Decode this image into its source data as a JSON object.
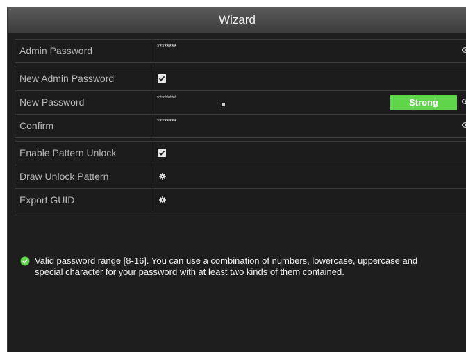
{
  "window": {
    "title": "Wizard"
  },
  "admin": {
    "label": "Admin Password",
    "value": "********"
  },
  "change": {
    "new_admin_label": "New Admin Password",
    "new_admin_checked": true,
    "new_password_label": "New Password",
    "new_password_value": "********",
    "strength_label": "Strong",
    "confirm_label": "Confirm",
    "confirm_value": "********"
  },
  "pattern": {
    "enable_label": "Enable Pattern Unlock",
    "enable_checked": true,
    "draw_label": "Draw Unlock Pattern",
    "export_label": "Export GUID"
  },
  "hint": {
    "text": "Valid password range [8-16]. You can use a combination of numbers, lowercase, uppercase and special character for your password with at least two kinds of them contained.",
    "icon": "check-circle-icon",
    "icon_color": "#5fd64a"
  },
  "colors": {
    "strength_bg": "#5fd64a",
    "window_bg": "#1e1e1e"
  }
}
